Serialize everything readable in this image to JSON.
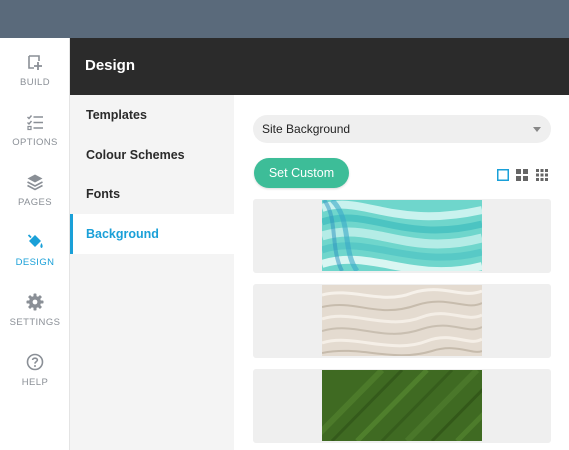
{
  "nav": {
    "items": [
      {
        "label": "BUILD",
        "icon": "build-icon"
      },
      {
        "label": "OPTIONS",
        "icon": "options-icon"
      },
      {
        "label": "PAGES",
        "icon": "pages-icon"
      },
      {
        "label": "DESIGN",
        "icon": "design-icon",
        "active": true
      },
      {
        "label": "SETTINGS",
        "icon": "settings-icon"
      },
      {
        "label": "HELP",
        "icon": "help-icon"
      }
    ]
  },
  "panel": {
    "title": "Design"
  },
  "submenu": {
    "items": [
      {
        "label": "Templates"
      },
      {
        "label": "Colour Schemes"
      },
      {
        "label": "Fonts"
      },
      {
        "label": "Background",
        "active": true
      }
    ]
  },
  "background": {
    "select_value": "Site Background",
    "set_custom_label": "Set Custom",
    "view_options": [
      "large-grid-icon",
      "medium-grid-icon",
      "small-grid-icon"
    ],
    "thumbnails": [
      "aqua brushstrokes",
      "sand ripples",
      "green leaf"
    ]
  },
  "colors": {
    "accent": "#1aa0d8",
    "button": "#3dbd98",
    "header": "#2b2b2b",
    "topbar": "#5a6a7b"
  }
}
